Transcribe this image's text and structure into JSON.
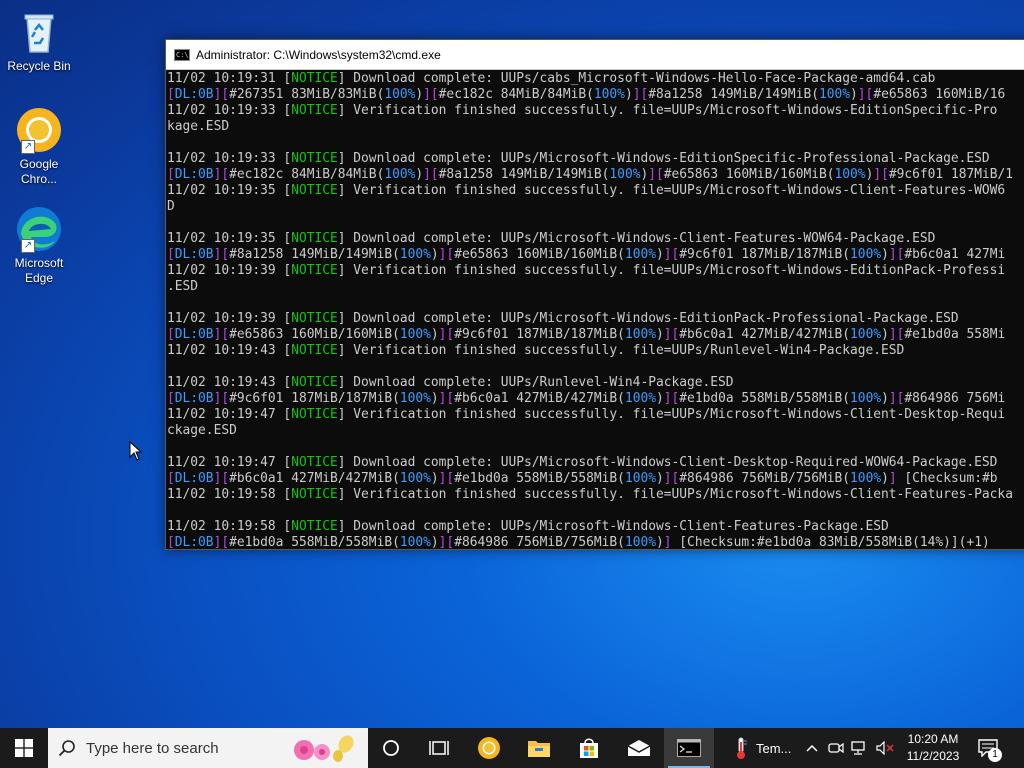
{
  "desktop": {
    "icons": [
      {
        "label": "Recycle Bin"
      },
      {
        "label": "Google Chro..."
      },
      {
        "label": "Microsoft Edge"
      }
    ]
  },
  "window": {
    "title": "Administrator: C:\\Windows\\system32\\cmd.exe"
  },
  "console": {
    "lines": [
      [
        [
          "11/02 10:19:31 [",
          ""
        ],
        [
          "NOTICE",
          "g"
        ],
        [
          "] Download complete: UUPs/cabs_Microsoft-Windows-Hello-Face-Package-amd64.cab",
          ""
        ]
      ],
      [
        [
          "[",
          "p"
        ],
        [
          "DL:0B",
          "b"
        ],
        [
          "][",
          "p"
        ],
        [
          "#267351 83MiB/83MiB(",
          ""
        ],
        [
          "100%",
          "b"
        ],
        [
          ")",
          ""
        ],
        [
          "][",
          "p"
        ],
        [
          "#ec182c 84MiB/84MiB(",
          ""
        ],
        [
          "100%",
          "b"
        ],
        [
          ")",
          ""
        ],
        [
          "][",
          "p"
        ],
        [
          "#8a1258 149MiB/149MiB(",
          ""
        ],
        [
          "100%",
          "b"
        ],
        [
          ")",
          ""
        ],
        [
          "][",
          "p"
        ],
        [
          "#e65863 160MiB/16",
          ""
        ]
      ],
      [
        [
          "11/02 10:19:33 [",
          ""
        ],
        [
          "NOTICE",
          "g"
        ],
        [
          "] Verification finished successfully. file=UUPs/Microsoft-Windows-EditionSpecific-Pro",
          ""
        ]
      ],
      [
        [
          "kage.ESD",
          ""
        ]
      ],
      [
        [
          "",
          ""
        ]
      ],
      [
        [
          "11/02 10:19:33 [",
          ""
        ],
        [
          "NOTICE",
          "g"
        ],
        [
          "] Download complete: UUPs/Microsoft-Windows-EditionSpecific-Professional-Package.ESD",
          ""
        ]
      ],
      [
        [
          "[",
          "p"
        ],
        [
          "DL:0B",
          "b"
        ],
        [
          "][",
          "p"
        ],
        [
          "#ec182c 84MiB/84MiB(",
          ""
        ],
        [
          "100%",
          "b"
        ],
        [
          ")",
          ""
        ],
        [
          "][",
          "p"
        ],
        [
          "#8a1258 149MiB/149MiB(",
          ""
        ],
        [
          "100%",
          "b"
        ],
        [
          ")",
          ""
        ],
        [
          "][",
          "p"
        ],
        [
          "#e65863 160MiB/160MiB(",
          ""
        ],
        [
          "100%",
          "b"
        ],
        [
          ")",
          ""
        ],
        [
          "][",
          "p"
        ],
        [
          "#9c6f01 187MiB/1",
          ""
        ]
      ],
      [
        [
          "11/02 10:19:35 [",
          ""
        ],
        [
          "NOTICE",
          "g"
        ],
        [
          "] Verification finished successfully. file=UUPs/Microsoft-Windows-Client-Features-WOW6",
          ""
        ]
      ],
      [
        [
          "D",
          ""
        ]
      ],
      [
        [
          "",
          ""
        ]
      ],
      [
        [
          "11/02 10:19:35 [",
          ""
        ],
        [
          "NOTICE",
          "g"
        ],
        [
          "] Download complete: UUPs/Microsoft-Windows-Client-Features-WOW64-Package.ESD",
          ""
        ]
      ],
      [
        [
          "[",
          "p"
        ],
        [
          "DL:0B",
          "b"
        ],
        [
          "][",
          "p"
        ],
        [
          "#8a1258 149MiB/149MiB(",
          ""
        ],
        [
          "100%",
          "b"
        ],
        [
          ")",
          ""
        ],
        [
          "][",
          "p"
        ],
        [
          "#e65863 160MiB/160MiB(",
          ""
        ],
        [
          "100%",
          "b"
        ],
        [
          ")",
          ""
        ],
        [
          "][",
          "p"
        ],
        [
          "#9c6f01 187MiB/187MiB(",
          ""
        ],
        [
          "100%",
          "b"
        ],
        [
          ")",
          ""
        ],
        [
          "][",
          "p"
        ],
        [
          "#b6c0a1 427Mi",
          ""
        ]
      ],
      [
        [
          "11/02 10:19:39 [",
          ""
        ],
        [
          "NOTICE",
          "g"
        ],
        [
          "] Verification finished successfully. file=UUPs/Microsoft-Windows-EditionPack-Professi",
          ""
        ]
      ],
      [
        [
          ".ESD",
          ""
        ]
      ],
      [
        [
          "",
          ""
        ]
      ],
      [
        [
          "11/02 10:19:39 [",
          ""
        ],
        [
          "NOTICE",
          "g"
        ],
        [
          "] Download complete: UUPs/Microsoft-Windows-EditionPack-Professional-Package.ESD",
          ""
        ]
      ],
      [
        [
          "[",
          "p"
        ],
        [
          "DL:0B",
          "b"
        ],
        [
          "][",
          "p"
        ],
        [
          "#e65863 160MiB/160MiB(",
          ""
        ],
        [
          "100%",
          "b"
        ],
        [
          ")",
          ""
        ],
        [
          "][",
          "p"
        ],
        [
          "#9c6f01 187MiB/187MiB(",
          ""
        ],
        [
          "100%",
          "b"
        ],
        [
          ")",
          ""
        ],
        [
          "][",
          "p"
        ],
        [
          "#b6c0a1 427MiB/427MiB(",
          ""
        ],
        [
          "100%",
          "b"
        ],
        [
          ")",
          ""
        ],
        [
          "][",
          "p"
        ],
        [
          "#e1bd0a 558Mi",
          ""
        ]
      ],
      [
        [
          "11/02 10:19:43 [",
          ""
        ],
        [
          "NOTICE",
          "g"
        ],
        [
          "] Verification finished successfully. file=UUPs/Runlevel-Win4-Package.ESD",
          ""
        ]
      ],
      [
        [
          "",
          ""
        ]
      ],
      [
        [
          "11/02 10:19:43 [",
          ""
        ],
        [
          "NOTICE",
          "g"
        ],
        [
          "] Download complete: UUPs/Runlevel-Win4-Package.ESD",
          ""
        ]
      ],
      [
        [
          "[",
          "p"
        ],
        [
          "DL:0B",
          "b"
        ],
        [
          "][",
          "p"
        ],
        [
          "#9c6f01 187MiB/187MiB(",
          ""
        ],
        [
          "100%",
          "b"
        ],
        [
          ")",
          ""
        ],
        [
          "][",
          "p"
        ],
        [
          "#b6c0a1 427MiB/427MiB(",
          ""
        ],
        [
          "100%",
          "b"
        ],
        [
          ")",
          ""
        ],
        [
          "][",
          "p"
        ],
        [
          "#e1bd0a 558MiB/558MiB(",
          ""
        ],
        [
          "100%",
          "b"
        ],
        [
          ")",
          ""
        ],
        [
          "][",
          "p"
        ],
        [
          "#864986 756Mi",
          ""
        ]
      ],
      [
        [
          "11/02 10:19:47 [",
          ""
        ],
        [
          "NOTICE",
          "g"
        ],
        [
          "] Verification finished successfully. file=UUPs/Microsoft-Windows-Client-Desktop-Requi",
          ""
        ]
      ],
      [
        [
          "ckage.ESD",
          ""
        ]
      ],
      [
        [
          "",
          ""
        ]
      ],
      [
        [
          "11/02 10:19:47 [",
          ""
        ],
        [
          "NOTICE",
          "g"
        ],
        [
          "] Download complete: UUPs/Microsoft-Windows-Client-Desktop-Required-WOW64-Package.ESD",
          ""
        ]
      ],
      [
        [
          "[",
          "p"
        ],
        [
          "DL:0B",
          "b"
        ],
        [
          "][",
          "p"
        ],
        [
          "#b6c0a1 427MiB/427MiB(",
          ""
        ],
        [
          "100%",
          "b"
        ],
        [
          ")",
          ""
        ],
        [
          "][",
          "p"
        ],
        [
          "#e1bd0a 558MiB/558MiB(",
          ""
        ],
        [
          "100%",
          "b"
        ],
        [
          ")",
          ""
        ],
        [
          "][",
          "p"
        ],
        [
          "#864986 756MiB/756MiB(",
          ""
        ],
        [
          "100%",
          "b"
        ],
        [
          ")",
          ""
        ],
        [
          "] ",
          "p"
        ],
        [
          "[Checksum:#b",
          ""
        ]
      ],
      [
        [
          "11/02 10:19:58 [",
          ""
        ],
        [
          "NOTICE",
          "g"
        ],
        [
          "] Verification finished successfully. file=UUPs/Microsoft-Windows-Client-Features-Packa",
          ""
        ]
      ],
      [
        [
          "",
          ""
        ]
      ],
      [
        [
          "11/02 10:19:58 [",
          ""
        ],
        [
          "NOTICE",
          "g"
        ],
        [
          "] Download complete: UUPs/Microsoft-Windows-Client-Features-Package.ESD",
          ""
        ]
      ],
      [
        [
          "[",
          "p"
        ],
        [
          "DL:0B",
          "b"
        ],
        [
          "][",
          "p"
        ],
        [
          "#e1bd0a 558MiB/558MiB(",
          ""
        ],
        [
          "100%",
          "b"
        ],
        [
          ")",
          ""
        ],
        [
          "][",
          "p"
        ],
        [
          "#864986 756MiB/756MiB(",
          ""
        ],
        [
          "100%",
          "b"
        ],
        [
          ")",
          ""
        ],
        [
          "] ",
          "p"
        ],
        [
          "[Checksum:#e1bd0a 83MiB/558MiB(14%)](+1)",
          ""
        ]
      ]
    ]
  },
  "taskbar": {
    "search_placeholder": "Type here to search",
    "weather_label": "Tem...",
    "time": "10:20 AM",
    "date": "11/2/2023",
    "notification_count": "1"
  }
}
